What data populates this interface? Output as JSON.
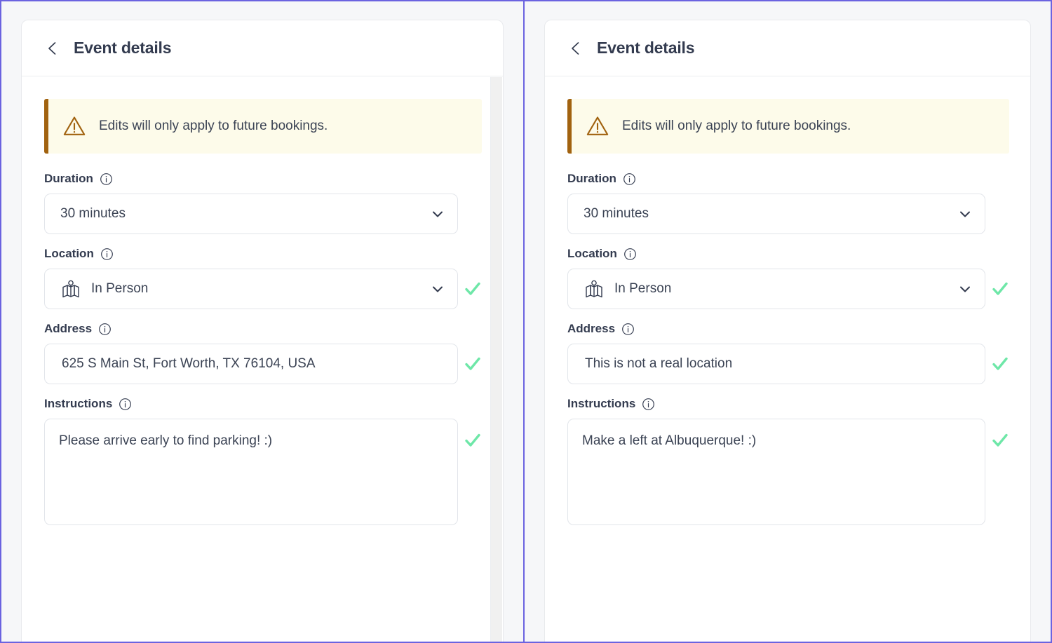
{
  "theme": {
    "background": "#f6f7f9",
    "card_background": "#ffffff",
    "divider": "#6b63e0",
    "title_color": "#333b4f",
    "banner_background": "#fdfbea",
    "banner_accent": "#a1620f",
    "valid_check_color": "#6ee7a8",
    "border_color": "#e2e5ea"
  },
  "panels": [
    {
      "id": "left",
      "header": {
        "back_icon": "chevron-left-icon",
        "title": "Event details"
      },
      "banner": {
        "icon": "warning-triangle-icon",
        "text": "Edits will only apply to future bookings."
      },
      "fields": {
        "duration": {
          "label": "Duration",
          "info_icon": "info-circle-icon",
          "type": "select",
          "value": "30 minutes",
          "chevron": "chevron-down-icon",
          "valid": false
        },
        "location": {
          "label": "Location",
          "info_icon": "info-circle-icon",
          "type": "select",
          "leading_icon": "map-pin-icon",
          "value": "In Person",
          "chevron": "chevron-down-icon",
          "valid": true
        },
        "address": {
          "label": "Address",
          "info_icon": "info-circle-icon",
          "type": "text",
          "value": "625 S Main St, Fort Worth, TX 76104, USA",
          "valid": true
        },
        "instructions": {
          "label": "Instructions",
          "info_icon": "info-circle-icon",
          "type": "textarea",
          "value": "Please arrive early to find parking! :)",
          "valid": true
        }
      },
      "scrollbar": true
    },
    {
      "id": "right",
      "header": {
        "back_icon": "chevron-left-icon",
        "title": "Event details"
      },
      "banner": {
        "icon": "warning-triangle-icon",
        "text": "Edits will only apply to future bookings."
      },
      "fields": {
        "duration": {
          "label": "Duration",
          "info_icon": "info-circle-icon",
          "type": "select",
          "value": "30 minutes",
          "chevron": "chevron-down-icon",
          "valid": false
        },
        "location": {
          "label": "Location",
          "info_icon": "info-circle-icon",
          "type": "select",
          "leading_icon": "map-pin-icon",
          "value": "In Person",
          "chevron": "chevron-down-icon",
          "valid": true
        },
        "address": {
          "label": "Address",
          "info_icon": "info-circle-icon",
          "type": "text",
          "value": "This is not a real location",
          "valid": true
        },
        "instructions": {
          "label": "Instructions",
          "info_icon": "info-circle-icon",
          "type": "textarea",
          "value": "Make a left at Albuquerque! :)",
          "valid": true
        }
      },
      "scrollbar": false
    }
  ]
}
